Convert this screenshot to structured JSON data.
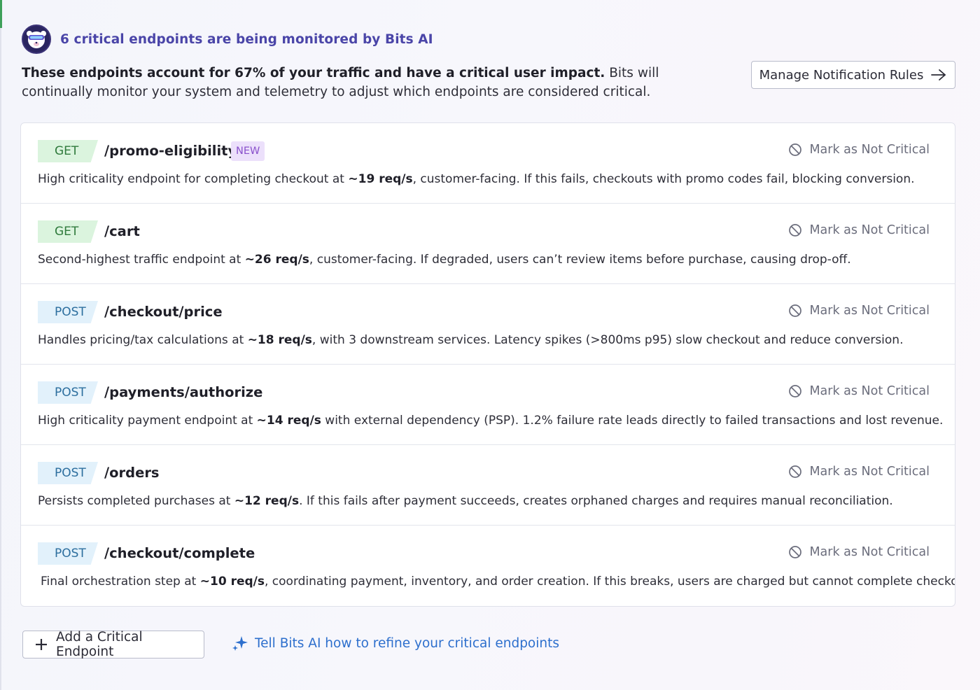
{
  "header": {
    "title": "6 critical endpoints are being monitored by Bits AI",
    "intro_bold": "These endpoints account for 67% of your traffic and have a critical user impact.",
    "intro_rest": " Bits will continually monitor your system and telemetry to adjust which endpoints are considered critical.",
    "manage_button": "Manage Notification Rules"
  },
  "endpoints": [
    {
      "method": "GET",
      "path": "/promo-eligibility",
      "badge": "NEW",
      "action": "Mark as Not Critical",
      "desc_pre": "High criticality endpoint for completing checkout at ",
      "desc_rate": "~19 req/s",
      "desc_post": ", customer-facing. If this fails, checkouts with promo codes fail, blocking conversion."
    },
    {
      "method": "GET",
      "path": "/cart",
      "action": "Mark as Not Critical",
      "desc_pre": "Second-highest traffic endpoint at ",
      "desc_rate": "~26 req/s",
      "desc_post": ", customer-facing. If degraded, users can’t review items before purchase, causing drop-off."
    },
    {
      "method": "POST",
      "path": "/checkout/price",
      "action": "Mark as Not Critical",
      "desc_pre": "Handles pricing/tax calculations at ",
      "desc_rate": "~18 req/s",
      "desc_post": ", with 3 downstream services. Latency spikes (>800ms p95) slow checkout and reduce conversion."
    },
    {
      "method": "POST",
      "path": "/payments/authorize",
      "action": "Mark as Not Critical",
      "desc_pre": "High criticality payment endpoint at ",
      "desc_rate": "~14 req/s",
      "desc_post": " with external dependency (PSP). 1.2% failure rate leads directly to failed transactions and lost revenue."
    },
    {
      "method": "POST",
      "path": "/orders",
      "action": "Mark as Not Critical",
      "desc_pre": "Persists completed purchases at ",
      "desc_rate": "~12 req/s",
      "desc_post": ". If this fails after payment succeeds, creates orphaned charges and requires manual reconciliation."
    },
    {
      "method": "POST",
      "path": "/checkout/complete",
      "action": "Mark as Not Critical",
      "desc_pre": "Final orchestration step at ",
      "desc_rate": "~10 req/s",
      "desc_post": ", coordinating payment, inventory, and order creation. If this breaks, users are charged but cannot complete checkout."
    }
  ],
  "footer": {
    "add_button": "Add a Critical Endpoint",
    "refine_link": "Tell Bits AI how to refine your critical endpoints"
  },
  "icons": {
    "avatar": "bits-ai-avatar-icon",
    "manage_arrow": "arrow-right-icon",
    "mark_action": "ban-icon",
    "add": "plus-icon",
    "refine": "sparkle-icon"
  },
  "colors": {
    "get_bg": "#dbf4de",
    "get_text": "#2f7a3c",
    "post_bg": "#e2f1fb",
    "post_text": "#2c6e9e",
    "new_bg": "#ece0fb",
    "new_text": "#8a52cc",
    "link": "#2d6fcd",
    "title": "#4a45a8"
  }
}
